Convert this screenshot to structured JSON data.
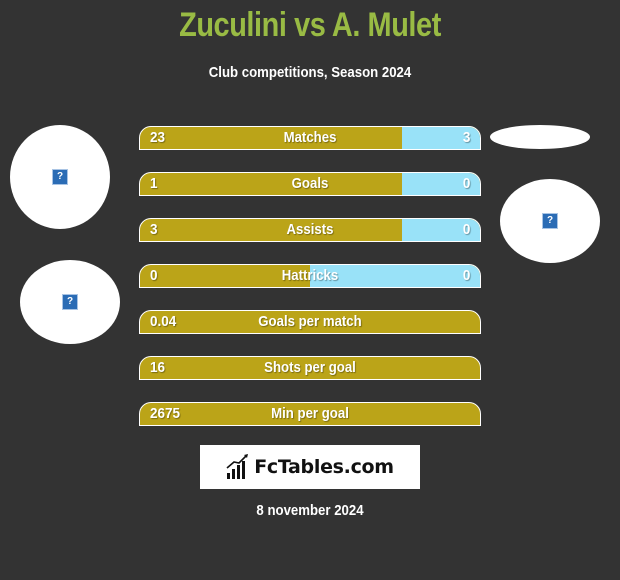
{
  "header": {
    "title": "Zuculini vs A. Mulet",
    "subtitle": "Club competitions, Season 2024"
  },
  "colors": {
    "background": "#333333",
    "title": "#99bb44",
    "left_bar": "#bba418",
    "right_bar": "#99e2f8"
  },
  "stats": [
    {
      "label": "Matches",
      "left": "23",
      "right": "3",
      "right_share": 0.23
    },
    {
      "label": "Goals",
      "left": "1",
      "right": "0",
      "right_share": 0.23
    },
    {
      "label": "Assists",
      "left": "3",
      "right": "0",
      "right_share": 0.23
    },
    {
      "label": "Hattricks",
      "left": "0",
      "right": "0",
      "right_share": 0.5
    },
    {
      "label": "Goals per match",
      "left": "0.04",
      "right": null,
      "right_share": 0
    },
    {
      "label": "Shots per goal",
      "left": "16",
      "right": null,
      "right_share": 0
    },
    {
      "label": "Min per goal",
      "left": "2675",
      "right": null,
      "right_share": 0
    }
  ],
  "images": {
    "player1_logo": "broken-image-icon",
    "player1_team": "broken-image-icon",
    "player2_logo": "broken-image-icon"
  },
  "branding": {
    "logo_text": "FcTables.com",
    "logo_icon": "bar-chart-icon"
  },
  "footer": {
    "date": "8 november 2024"
  }
}
